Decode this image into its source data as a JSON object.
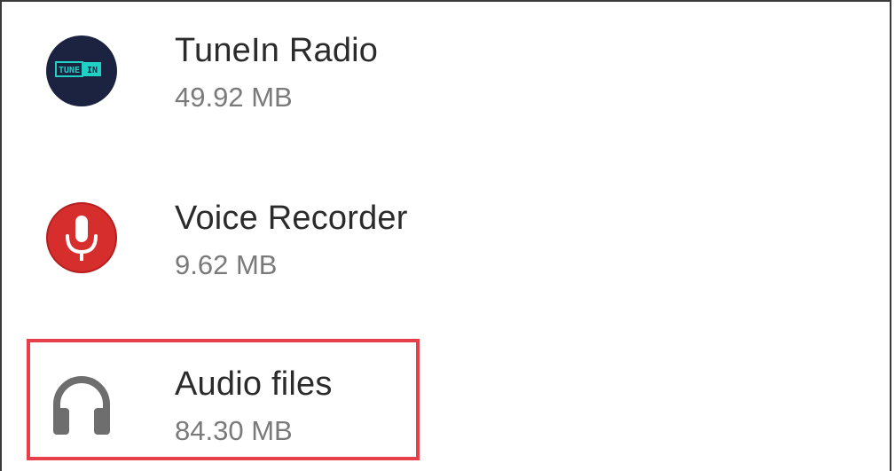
{
  "items": [
    {
      "name": "TuneIn Radio",
      "size": "49.92 MB",
      "icon": "tunein-icon",
      "icon_text": "TUNE IN"
    },
    {
      "name": "Voice Recorder",
      "size": "9.62 MB",
      "icon": "microphone-icon"
    },
    {
      "name": "Audio files",
      "size": "84.30 MB",
      "icon": "headphones-icon"
    }
  ],
  "colors": {
    "tunein_bg": "#1c2340",
    "tunein_accent": "#1fd1c4",
    "recorder_red": "#d62d2d",
    "headphones_gray": "#6e6e6e",
    "highlight_border": "#e8404a"
  }
}
